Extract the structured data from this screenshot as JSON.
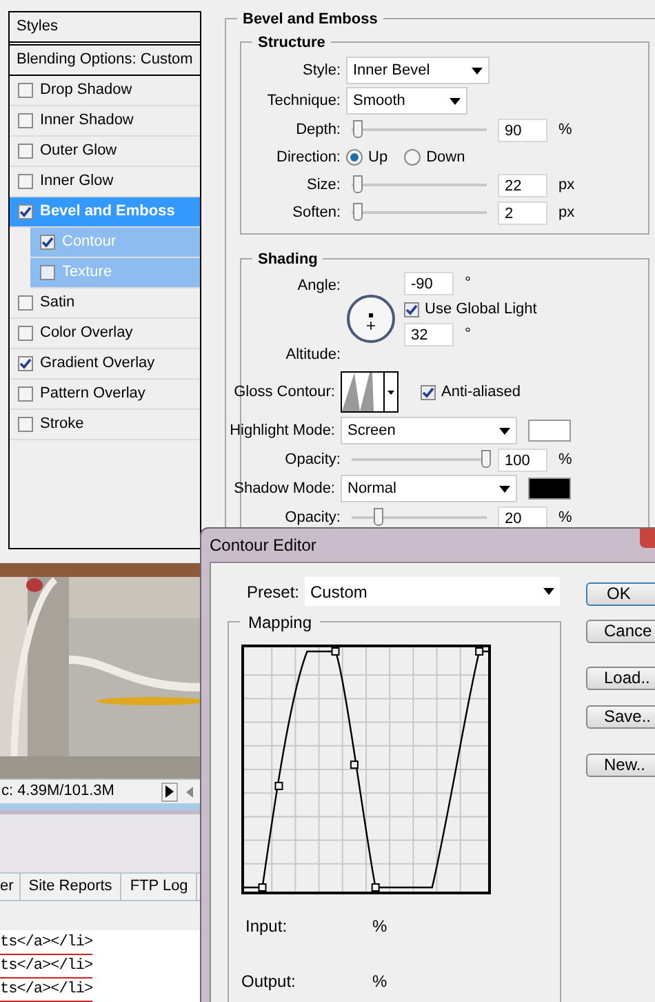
{
  "styles_panel": {
    "title": "Styles",
    "blending_options": "Blending Options: Custom",
    "effects": [
      {
        "label": "Drop Shadow",
        "checked": false,
        "selected": false
      },
      {
        "label": "Inner Shadow",
        "checked": false,
        "selected": false
      },
      {
        "label": "Outer Glow",
        "checked": false,
        "selected": false
      },
      {
        "label": "Inner Glow",
        "checked": false,
        "selected": false
      },
      {
        "label": "Bevel and Emboss",
        "checked": true,
        "selected": true,
        "children": [
          {
            "label": "Contour",
            "checked": true
          },
          {
            "label": "Texture",
            "checked": false
          }
        ]
      },
      {
        "label": "Satin",
        "checked": false,
        "selected": false
      },
      {
        "label": "Color Overlay",
        "checked": false,
        "selected": false
      },
      {
        "label": "Gradient Overlay",
        "checked": true,
        "selected": false
      },
      {
        "label": "Pattern Overlay",
        "checked": false,
        "selected": false
      },
      {
        "label": "Stroke",
        "checked": false,
        "selected": false
      }
    ]
  },
  "bevel_emboss": {
    "title": "Bevel and Emboss",
    "structure": {
      "title": "Structure",
      "rows": [
        {
          "kind": "dropdown",
          "label": "Style:",
          "value": "Inner Bevel"
        },
        {
          "kind": "dropdown",
          "label": "Technique:",
          "value": "Smooth"
        },
        {
          "kind": "slider",
          "label": "Depth:",
          "level": 0.05,
          "value": "90",
          "unit": "%"
        },
        {
          "kind": "radio",
          "label": "Direction:",
          "options": [
            {
              "label": "Up",
              "selected": true
            },
            {
              "label": "Down",
              "selected": false
            }
          ]
        },
        {
          "kind": "slider",
          "label": "Size:",
          "level": 0.05,
          "value": "22",
          "unit": "px"
        },
        {
          "kind": "slider",
          "label": "Soften:",
          "level": 0.05,
          "value": "2",
          "unit": "px"
        }
      ]
    },
    "shading": {
      "title": "Shading",
      "angle": {
        "label": "Angle:",
        "value": "-90",
        "unit": "°"
      },
      "use_global_light": {
        "label": "Use Global Light",
        "checked": true
      },
      "altitude": {
        "label": "Altitude:",
        "value": "32",
        "unit": "°"
      },
      "gloss_contour": {
        "label": "Gloss Contour:"
      },
      "anti_aliased": {
        "label": "Anti-aliased",
        "checked": true
      },
      "rows": [
        {
          "kind": "mode",
          "label": "Highlight Mode:",
          "value": "Screen",
          "color": "#ffffff"
        },
        {
          "kind": "slider",
          "label": "Opacity:",
          "level": 1,
          "value": "100",
          "unit": "%"
        },
        {
          "kind": "mode",
          "label": "Shadow Mode:",
          "value": "Normal",
          "color": "#000000"
        },
        {
          "kind": "slider",
          "label": "Opacity:",
          "level": 0.2,
          "value": "20",
          "unit": "%"
        }
      ]
    }
  },
  "canvas": {
    "status": "c: 4.39M/101.3M"
  },
  "site_panel": {
    "tabs": [
      "er",
      "Site Reports",
      "FTP Log"
    ],
    "code_lines": [
      "ts</a></li>",
      "ts</a></li>",
      "ts</a></li>"
    ]
  },
  "contour_editor": {
    "title": "Contour Editor",
    "preset": {
      "label": "Preset:",
      "value": "Custom"
    },
    "mapping": {
      "title": "Mapping",
      "input": {
        "label": "Input:",
        "unit": "%"
      },
      "output": {
        "label": "Output:",
        "unit": "%"
      }
    },
    "buttons": [
      {
        "label": "OK",
        "default": true
      },
      {
        "label": "Cance",
        "default": false
      },
      {
        "label": "Load..",
        "default": false
      },
      {
        "label": "Save..",
        "default": false
      },
      {
        "label": "New..",
        "default": false
      }
    ]
  }
}
